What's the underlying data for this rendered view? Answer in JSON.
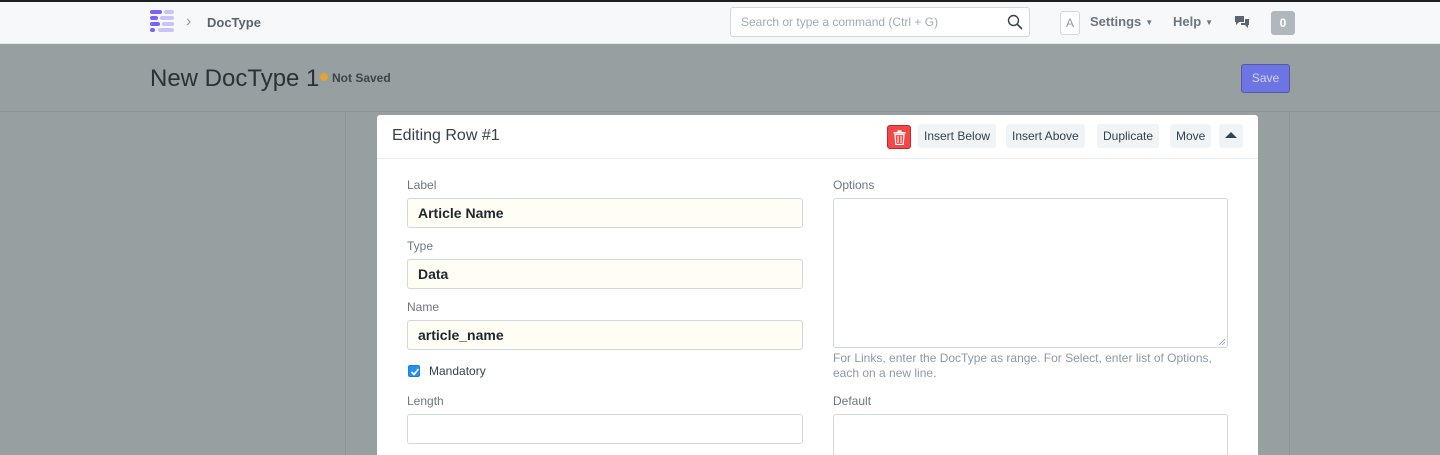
{
  "navbar": {
    "breadcrumb": "DocType",
    "search_placeholder": "Search or type a command (Ctrl + G)",
    "avatar_letter": "A",
    "settings_label": "Settings",
    "help_label": "Help",
    "notification_count": "0"
  },
  "page": {
    "title": "New DocType 1",
    "status": "Not Saved",
    "save_label": "Save"
  },
  "editor": {
    "title": "Editing Row #1",
    "actions": {
      "insert_below": "Insert Below",
      "insert_above": "Insert Above",
      "duplicate": "Duplicate",
      "move": "Move"
    },
    "fields": {
      "label": {
        "label": "Label",
        "value": "Article Name"
      },
      "type": {
        "label": "Type",
        "value": "Data"
      },
      "name": {
        "label": "Name",
        "value": "article_name"
      },
      "mandatory": {
        "label": "Mandatory",
        "checked": true
      },
      "length": {
        "label": "Length",
        "value": ""
      },
      "options": {
        "label": "Options",
        "value": "",
        "help": "For Links, enter the DocType as range. For Select, enter list of Options, each on a new line."
      },
      "default": {
        "label": "Default",
        "value": ""
      }
    }
  },
  "colors": {
    "primary": "#5e64ff",
    "danger": "#f44848",
    "checkbox": "#2490ef",
    "status_dot": "#e5a235"
  },
  "icons": [
    "app-logo-icon",
    "chevron-right-icon",
    "search-icon",
    "caret-down-icon",
    "chat-icon",
    "trash-icon",
    "collapse-up-icon",
    "checkmark-icon"
  ]
}
